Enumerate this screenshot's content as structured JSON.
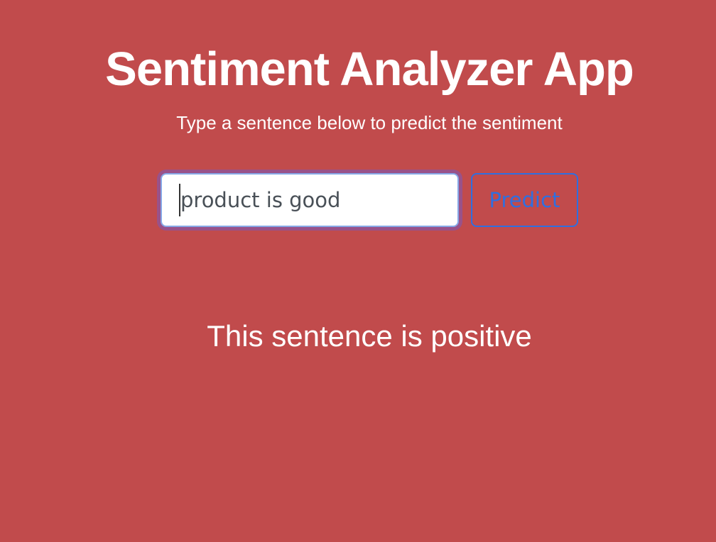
{
  "app": {
    "title": "Sentiment Analyzer App",
    "subtitle": "Type a sentence below to predict the sentiment"
  },
  "form": {
    "input_value": "product is good",
    "predict_label": "Predict"
  },
  "result": {
    "text": "This sentence is positive"
  },
  "colors": {
    "background": "#c14b4c",
    "text": "#ffffff",
    "button_accent": "#2f6fe0",
    "input_border": "#86a8e7"
  }
}
